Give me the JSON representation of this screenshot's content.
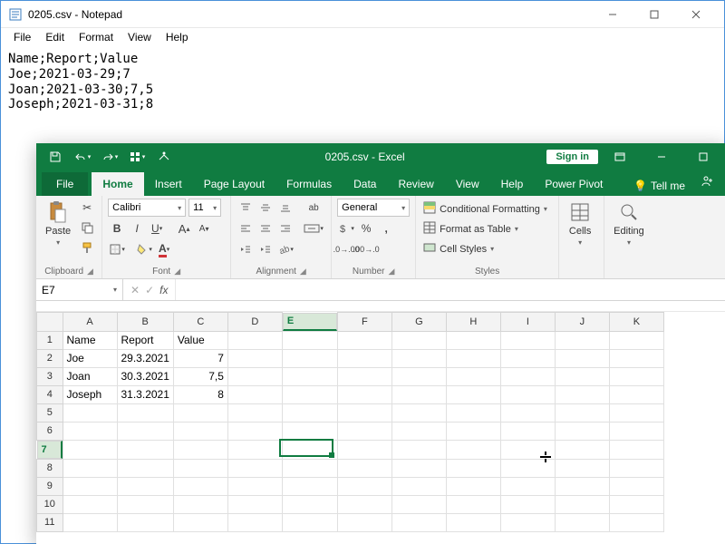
{
  "notepad": {
    "title": "0205.csv - Notepad",
    "menu": [
      "File",
      "Edit",
      "Format",
      "View",
      "Help"
    ],
    "content": "Name;Report;Value\nJoe;2021-03-29;7\nJoan;2021-03-30;7,5\nJoseph;2021-03-31;8"
  },
  "excel": {
    "qat": {
      "save": "save-icon",
      "undo": "undo-icon",
      "redo": "redo-icon",
      "touch": "touch-mode-icon",
      "custom": "customize-qat-icon"
    },
    "title": "0205.csv - Excel",
    "signin": "Sign in",
    "tabs": [
      "File",
      "Home",
      "Insert",
      "Page Layout",
      "Formulas",
      "Data",
      "Review",
      "View",
      "Help",
      "Power Pivot"
    ],
    "active_tab": "Home",
    "tellme": "Tell me",
    "ribbon": {
      "clipboard": {
        "paste": "Paste",
        "label": "Clipboard"
      },
      "font": {
        "name": "Calibri",
        "size": "11",
        "label": "Font"
      },
      "alignment": {
        "wrap": "",
        "label": "Alignment"
      },
      "number": {
        "format": "General",
        "label": "Number"
      },
      "styles": {
        "cond": "Conditional Formatting",
        "table": "Format as Table",
        "cellstyles": "Cell Styles",
        "label": "Styles"
      },
      "cells": {
        "btn": "Cells",
        "label": ""
      },
      "editing": {
        "btn": "Editing",
        "label": ""
      }
    },
    "namebox": "E7",
    "formula": "",
    "columns": [
      "A",
      "B",
      "C",
      "D",
      "E",
      "F",
      "G",
      "H",
      "I",
      "J",
      "K"
    ],
    "row_count": 11,
    "selected_col": "E",
    "selected_row": 7,
    "data": {
      "headers": [
        "Name",
        "Report",
        "Value"
      ],
      "rows": [
        {
          "name": "Joe",
          "report": "29.3.2021",
          "value": "7"
        },
        {
          "name": "Joan",
          "report": "30.3.2021",
          "value": "7,5"
        },
        {
          "name": "Joseph",
          "report": "31.3.2021",
          "value": "8"
        }
      ]
    }
  }
}
